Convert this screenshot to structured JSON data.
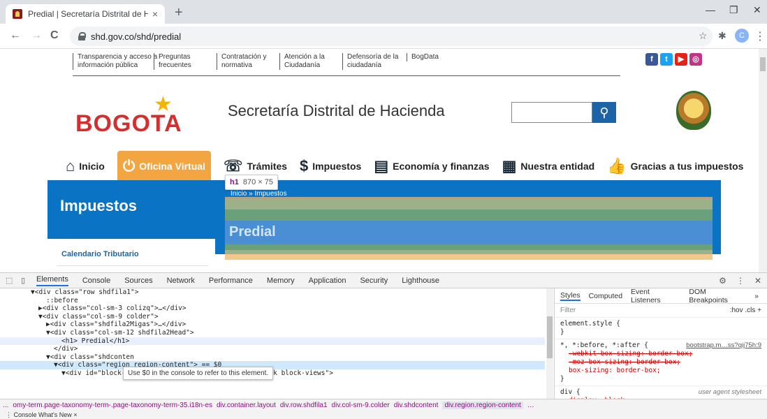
{
  "browser": {
    "tab_title": "Predial | Secretaría Distrital de Ha",
    "tab_close": "×",
    "new_tab": "+",
    "url": "shd.gov.co/shd/predial",
    "avatar_letter": "C",
    "window_min": "—",
    "window_restore": "❐",
    "window_close": "✕",
    "back": "←",
    "forward": "→",
    "reload": "C",
    "star": "☆",
    "extensions": "✱",
    "menu": "⋮"
  },
  "page": {
    "top_links": [
      {
        "line1": "Transparencia y acceso a",
        "line2": "información pública"
      },
      {
        "line1": "Preguntas",
        "line2": "frecuentes"
      },
      {
        "line1": "Contratación y",
        "line2": "normativa"
      },
      {
        "line1": "Atención a la",
        "line2": "Ciudadanía"
      },
      {
        "line1": "Defensoría de la",
        "line2": "ciudadanía"
      },
      {
        "line1": "BogData",
        "line2": ""
      }
    ],
    "social": [
      "f",
      "t",
      "▶",
      "◎"
    ],
    "logo_text": "BOGOTA",
    "site_title": "Secretaría Distrital de Hacienda",
    "search_button_icon": "🔍",
    "menu": [
      {
        "icon": "⌂",
        "label": "Inicio"
      },
      {
        "icon": "⏻",
        "label": "Oficina Virtual"
      },
      {
        "icon": "☏",
        "label": "Trámites"
      },
      {
        "icon": "$",
        "label": "Impuestos"
      },
      {
        "icon": "▤",
        "label": "Economía y finanzas"
      },
      {
        "icon": "▦",
        "label": "Nuestra entidad"
      },
      {
        "icon": "👍",
        "label": "Gracias a tus impuestos"
      }
    ],
    "banner_title": "Impuestos",
    "breadcrumb": "Inicio » Impuestos",
    "h1": "Predial",
    "sidebar_link": "Calendario Tributario",
    "element_tooltip": {
      "tag": "h1",
      "dims": "870 × 75"
    }
  },
  "devtools": {
    "tabs": [
      "Elements",
      "Console",
      "Sources",
      "Network",
      "Performance",
      "Memory",
      "Application",
      "Security",
      "Lighthouse"
    ],
    "dom_lines": [
      {
        "indent": 4,
        "text": "▼<div class=\"row shdfila1\">"
      },
      {
        "indent": 6,
        "text": "::before"
      },
      {
        "indent": 5,
        "text": "▶<div class=\"col-sm-3 colizq\">…</div>"
      },
      {
        "indent": 5,
        "text": "▼<div class=\"col-sm-9 colder\">"
      },
      {
        "indent": 6,
        "text": "▶<div class=\"shdfila2Migas\">…</div>"
      },
      {
        "indent": 6,
        "text": "▼<div class=\"col-sm-12 shdfila2Head\">"
      },
      {
        "indent": 8,
        "text": "<h1> Predial</h1>"
      },
      {
        "indent": 7,
        "text": "</div>"
      },
      {
        "indent": 6,
        "text": "▼<div class=\"shdconten"
      },
      {
        "indent": 7,
        "text": "▼<div class=\"region region-content\"> == $0"
      },
      {
        "indent": 8,
        "text": "▼<div id=\"block-views-documentos-block-1\" class=\"block block-views\">"
      }
    ],
    "dom_tooltip": "Use $0 in the console to refer to this element.",
    "styles_tabs": [
      "Styles",
      "Computed",
      "Event Listeners",
      "DOM Breakpoints",
      "»"
    ],
    "filter_placeholder": "Filter",
    "filter_tools": ":hov  .cls  +",
    "rules": [
      {
        "selector": "element.style {",
        "source": "",
        "props": [],
        "close": "}"
      },
      {
        "selector": "*, *:before, *:after {",
        "source": "bootstrap.m…ss?qij75h:9",
        "props": [
          {
            "text": "-webkit-box-sizing: border-box;",
            "struck": true
          },
          {
            "text": "-moz-box-sizing: border-box;",
            "struck": true
          },
          {
            "text": "box-sizing: border-box;",
            "struck": false
          }
        ],
        "close": "}"
      },
      {
        "selector": "div {",
        "source": "user agent stylesheet",
        "props": [
          {
            "text": "display: block;",
            "struck": false
          }
        ],
        "close": ""
      }
    ],
    "breadcrumbs": [
      "...",
      "omy-term.page-taxonomy-term-.page-taxonomy-term-35.i18n-es",
      "div.container.layout",
      "div.row.shdfila1",
      "div.col-sm-9.colder",
      "div.shdcontent",
      "div.region.region-content",
      "…"
    ],
    "drawer": "⋮   Console    What's New  ×"
  }
}
